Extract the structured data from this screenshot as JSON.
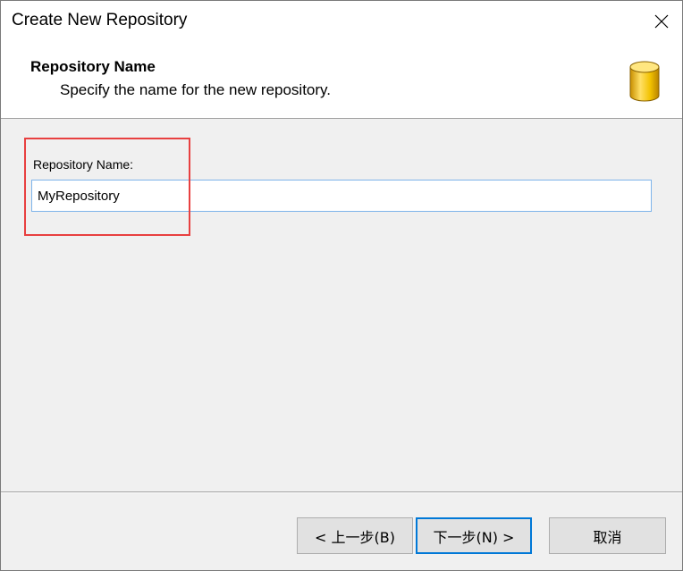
{
  "window": {
    "title": "Create New Repository"
  },
  "header": {
    "title": "Repository Name",
    "subtitle": "Specify the name for the new repository.",
    "icon": "database-icon"
  },
  "form": {
    "name_label": "Repository Name:",
    "name_value": "MyRepository"
  },
  "buttons": {
    "back_label": "< 上一步(B)",
    "next_label": "下一步(N) >",
    "cancel_label": "取消"
  },
  "colors": {
    "highlight": "#e84040",
    "focus_border": "#0078d7",
    "input_border": "#7eb4ea"
  }
}
